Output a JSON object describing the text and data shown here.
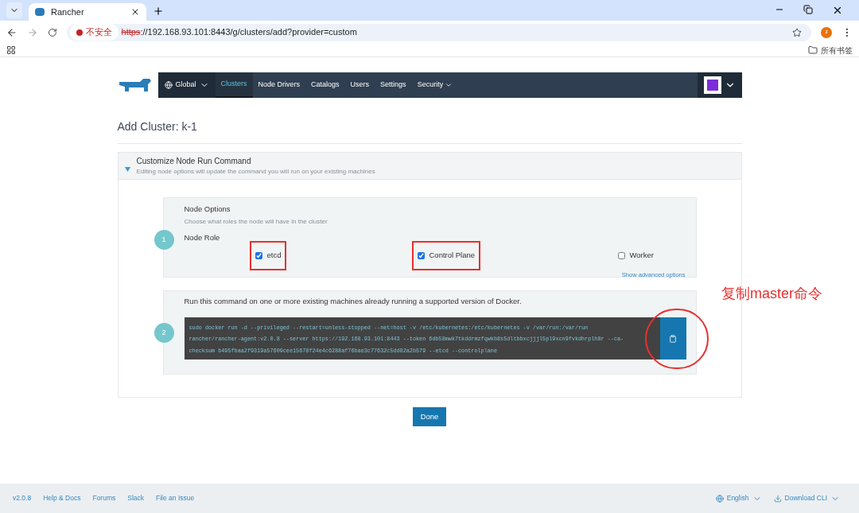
{
  "browser": {
    "tab_title": "Rancher",
    "security_label": "不安全",
    "url_scheme": "https",
    "url_rest": "://192.168.93.101:8443/g/clusters/add?provider=custom",
    "avatar_letter": "z",
    "bookmarks_label": "所有书签"
  },
  "nav": {
    "scope": "Global",
    "items": [
      {
        "label": "Clusters",
        "selected": true,
        "dropdown": false
      },
      {
        "label": "Node Drivers",
        "selected": false,
        "dropdown": false
      },
      {
        "label": "Catalogs",
        "selected": false,
        "dropdown": false
      },
      {
        "label": "Users",
        "selected": false,
        "dropdown": false
      },
      {
        "label": "Settings",
        "selected": false,
        "dropdown": false
      },
      {
        "label": "Security",
        "selected": false,
        "dropdown": true
      }
    ]
  },
  "page_title": "Add Cluster: k-1",
  "accordion": {
    "title": "Customize Node Run Command",
    "subtitle": "Editing node options will update the command you will run on your existing machines",
    "expanded": true
  },
  "step1": {
    "number": "1",
    "title": "Node Options",
    "description": "Choose what roles the node will have in the cluster",
    "role_label": "Node Role",
    "roles": [
      {
        "label": "etcd",
        "checked": true,
        "highlighted": true
      },
      {
        "label": "Control Plane",
        "checked": true,
        "highlighted": true
      },
      {
        "label": "Worker",
        "checked": false,
        "highlighted": false
      }
    ],
    "advanced_link": "Show advanced options"
  },
  "step2": {
    "number": "2",
    "instruction": "Run this command on one or more existing machines already running a supported version of Docker.",
    "command_lines": [
      "sudo docker run -d --privileged --restart=unless-stopped --net=host -v /etc/kubernetes:/etc/kubernetes -v /var/run:/var/run",
      "rancher/rancher-agent:v2.0.8 --server https://192.168.93.101:8443 --token 6db58mwk7tkddrmzfqwkb8s5dltbbxcjjjl5pl9xcn9fvkdhrplh8r --ca-",
      "checksum b495fbaa2f9319a57609cee15678f24e4c6288af76bae3c77632c5dd82a2b579 --etcd --controlplane"
    ],
    "copy_circled": true
  },
  "annotation": "复制master命令",
  "done_button": "Done",
  "footer": {
    "links": [
      "v2.0.8",
      "Help & Docs",
      "Forums",
      "Slack",
      "File an Issue"
    ],
    "language": "English",
    "download": "Download CLI"
  }
}
